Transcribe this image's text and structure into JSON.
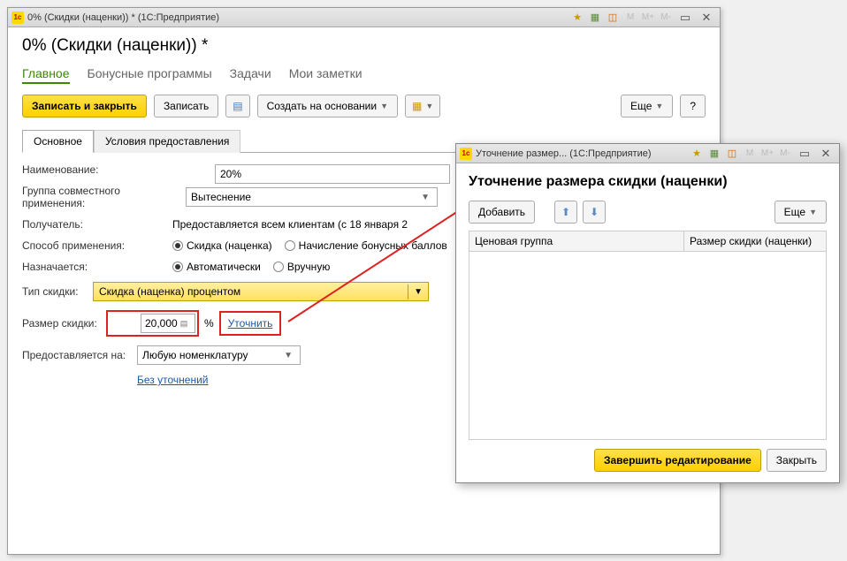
{
  "main": {
    "titlebar": "0% (Скидки (наценки)) *  (1С:Предприятие)",
    "page_title": "0% (Скидки (наценки)) *",
    "tabs": [
      "Главное",
      "Бонусные программы",
      "Задачи",
      "Мои заметки"
    ],
    "toolbar": {
      "save_close": "Записать и закрыть",
      "save": "Записать",
      "create_based": "Создать на основании",
      "more": "Еще",
      "help": "?"
    },
    "subtabs": [
      "Основное",
      "Условия предоставления"
    ],
    "form": {
      "name_label": "Наименование:",
      "name_value": "20%",
      "group_label": "Группа совместного применения:",
      "group_value": "Вытеснение",
      "recipient_label": "Получатель:",
      "recipient_value": "Предоставляется всем клиентам (с 18 января 2",
      "method_label": "Способ применения:",
      "method_opt1": "Скидка (наценка)",
      "method_opt2": "Начисление бонусных баллов",
      "assign_label": "Назначается:",
      "assign_opt1": "Автоматически",
      "assign_opt2": "Вручную",
      "type_label": "Тип скидки:",
      "type_value": "Скидка (наценка) процентом",
      "size_label": "Размер скидки:",
      "size_value": "20,000",
      "size_unit": "%",
      "clarify": "Уточнить",
      "provided_label": "Предоставляется на:",
      "provided_value": "Любую номенклатуру",
      "no_clarify": "Без уточнений"
    }
  },
  "dialog": {
    "titlebar": "Уточнение размер...  (1С:Предприятие)",
    "title": "Уточнение размера скидки (наценки)",
    "add": "Добавить",
    "more": "Еще",
    "col1": "Ценовая группа",
    "col2": "Размер скидки (наценки)",
    "finish": "Завершить редактирование",
    "close": "Закрыть"
  }
}
